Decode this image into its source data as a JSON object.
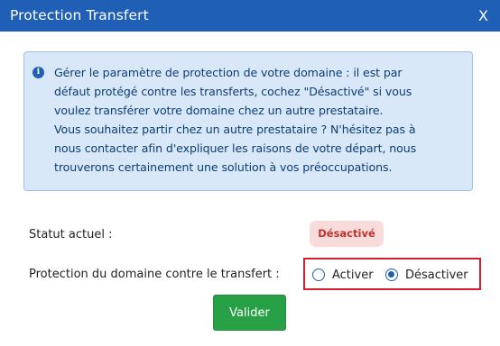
{
  "dialog": {
    "title": "Protection Transfert",
    "close_label": "X"
  },
  "info": {
    "icon": "info-circle-icon",
    "lines": [
      "Gérer le paramètre de protection de votre domaine : il est par",
      "défaut protégé contre les transferts, cochez \"Désactivé\" si vous",
      "voulez transférer votre domaine chez un autre prestataire.",
      "Vous souhaitez partir chez un autre prestataire ? N'hésitez pas à",
      "nous contacter afin d'expliquer les raisons de votre départ, nous",
      "trouverons certainement une solution à vos préoccupations."
    ]
  },
  "status": {
    "label": "Statut actuel :",
    "value": "Désactivé"
  },
  "protection": {
    "label": "Protection du domaine contre le transfert :",
    "options": [
      {
        "label": "Activer",
        "checked": false
      },
      {
        "label": "Désactiver",
        "checked": true
      }
    ]
  },
  "submit_label": "Valider",
  "colors": {
    "header": "#1f5fb5",
    "info_bg": "#d9e8f8",
    "badge_bg": "#f8dcdc",
    "badge_text": "#c0322f",
    "highlight_border": "#d61f2c",
    "submit_bg": "#28a046"
  }
}
